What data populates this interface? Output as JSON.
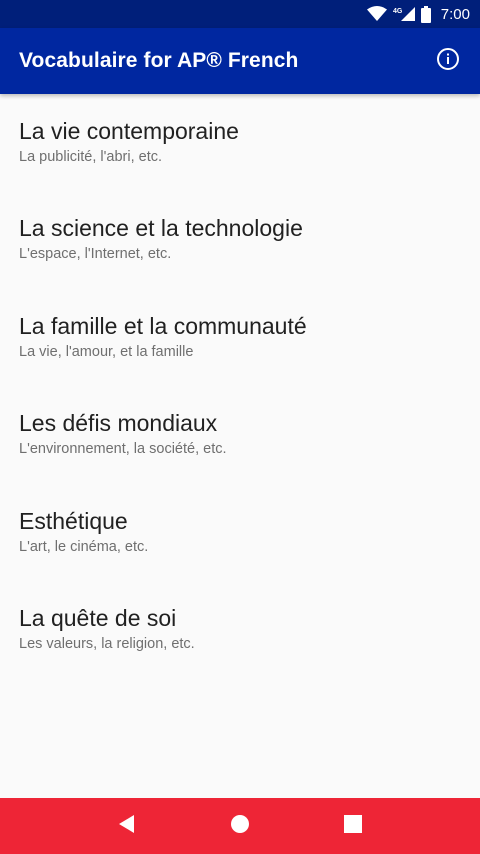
{
  "status_bar": {
    "network_label": "4G",
    "time": "7:00",
    "icons": [
      "wifi-icon",
      "cell-signal-icon",
      "battery-icon"
    ]
  },
  "app_bar": {
    "title": "Vocabulaire for AP® French",
    "info_icon": "info-icon"
  },
  "topics": [
    {
      "title": "La vie contemporaine",
      "subtitle": "La publicité, l'abri, etc."
    },
    {
      "title": "La science et la technologie",
      "subtitle": "L'espace, l'Internet, etc."
    },
    {
      "title": "La famille et la communauté",
      "subtitle": "La vie, l'amour, et la famille"
    },
    {
      "title": "Les défis mondiaux",
      "subtitle": "L'environnement, la société, etc."
    },
    {
      "title": "Esthétique",
      "subtitle": "L'art, le cinéma, etc."
    },
    {
      "title": "La quête de soi",
      "subtitle": "Les valeurs, la religion, etc."
    }
  ],
  "nav_bar": {
    "buttons": [
      "back-icon",
      "home-icon",
      "recents-icon"
    ]
  },
  "colors": {
    "status_bar": "#001f7a",
    "app_bar": "#0027a0",
    "nav_bar": "#ee2536",
    "background": "#fafafa",
    "title_text": "#212121",
    "subtitle_text": "#6f6f6f"
  }
}
